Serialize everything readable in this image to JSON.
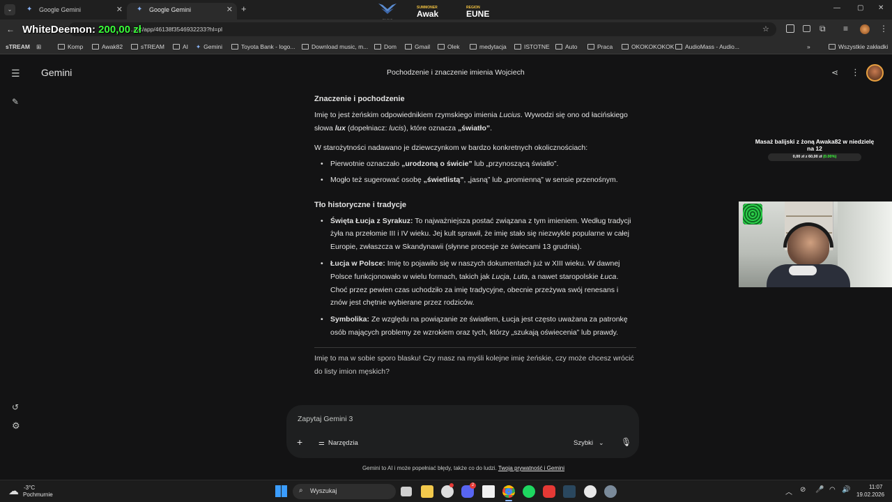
{
  "browser": {
    "tabs": [
      {
        "label": "Google Gemini",
        "active": false
      },
      {
        "label": "Google Gemini",
        "active": true
      }
    ],
    "url": "...om/app/46138f3546932233?hl=pl",
    "bookmarks": [
      "sTREAM",
      "Komp",
      "Awak82",
      "sTREAM",
      "AI",
      "Gemini",
      "Toyota Bank - logo...",
      "Download music, m...",
      "Dom",
      "Gmail",
      "Olek",
      "medytacja",
      "ISTOTNE",
      "Auto",
      "Praca",
      "OKOKOKOKOK",
      "AudioMass - Audio..."
    ],
    "all_bookmarks": "Wszystkie zakładki"
  },
  "stream": {
    "donation_name": "WhiteDeemon:",
    "donation_amount": "200,00 zł",
    "summoner_label": "SUMMONER",
    "summoner_name": "Awak",
    "region_label": "REGION",
    "region_name": "EUNE",
    "logo_text": "FN DLP",
    "goal_title": "Masaż balijski z żoną Awaka82 w niedzielę na 12",
    "goal_progress_text": "0,00 zł z 60,00 zł",
    "goal_percent": "(0.00%)"
  },
  "gemini": {
    "app_name": "Gemini",
    "conversation_title": "Pochodzenie i znaczenie imienia Wojciech",
    "section1_title": "Znaczenie i pochodzenie",
    "p1_a": "Imię to jest żeńskim odpowiednikiem rzymskiego imienia ",
    "p1_b": "Lucius",
    "p1_c": ". Wywodzi się ono od łacińskiego słowa ",
    "p1_d": "lux",
    "p1_e": " (dopełniacz: ",
    "p1_f": "lucis",
    "p1_g": "), które oznacza ",
    "p1_h": "„światło”",
    "p1_i": ".",
    "p2": "W starożytności nadawano je dziewczynkom w bardzo konkretnych okolicznościach:",
    "b1_a": "Pierwotnie oznaczało ",
    "b1_b": "„urodzoną o świcie”",
    "b1_c": " lub „przynoszącą światło”.",
    "b2_a": "Mogło też sugerować osobę ",
    "b2_b": "„świetlistą”",
    "b2_c": ", „jasną” lub „promienną” w sensie przenośnym.",
    "section2_title": "Tło historyczne i tradycje",
    "h1_b": "Święta Łucja z Syrakuz:",
    "h1_t": " To najważniejsza postać związana z tym imieniem. Według tradycji żyła na przełomie III i IV wieku. Jej kult sprawił, że imię stało się niezwykle popularne w całej Europie, zwłaszcza w Skandynawii (słynne procesje ze świecami 13 grudnia).",
    "h2_b": "Łucja w Polsce:",
    "h2_a": " Imię to pojawiło się w naszych dokumentach już w XIII wieku. W dawnej Polsce funkcjonowało w wielu formach, takich jak ",
    "h2_i1": "Lucja",
    "h2_s1": ", ",
    "h2_i2": "Luta",
    "h2_m": ", a nawet staropolskie ",
    "h2_i3": "Łuca",
    "h2_z": ". Choć przez pewien czas uchodziło za imię tradycyjne, obecnie przeżywa swój renesans i znów jest chętnie wybierane przez rodziców.",
    "h3_b": "Symbolika:",
    "h3_t": " Ze względu na powiązanie ze światłem, Łucja jest często uważana za patronkę osób mających problemy ze wzrokiem oraz tych, którzy „szukają oświecenia” lub prawdy.",
    "closing": "Imię to ma w sobie sporo blasku! Czy masz na myśli kolejne imię żeńskie, czy może chcesz wrócić do listy imion męskich?",
    "input_placeholder": "Zapytaj Gemini 3",
    "tools_label": "Narzędzia",
    "model_label": "Szybki",
    "disclaimer": "Gemini to AI i może popełniać błędy, także co do ludzi. ",
    "privacy_link": "Twoja prywatność i Gemini"
  },
  "taskbar": {
    "weather_temp": "-3°C",
    "weather_desc": "Pochmurnie",
    "search_label": "Wyszukaj",
    "time": "11:07",
    "date": "19.02.2026",
    "badge_count": "2"
  },
  "colors": {
    "bg": "#131314",
    "donation_green": "#3cff3c",
    "link": "#a8c7fa",
    "accent_blue": "#8ab4f8"
  }
}
